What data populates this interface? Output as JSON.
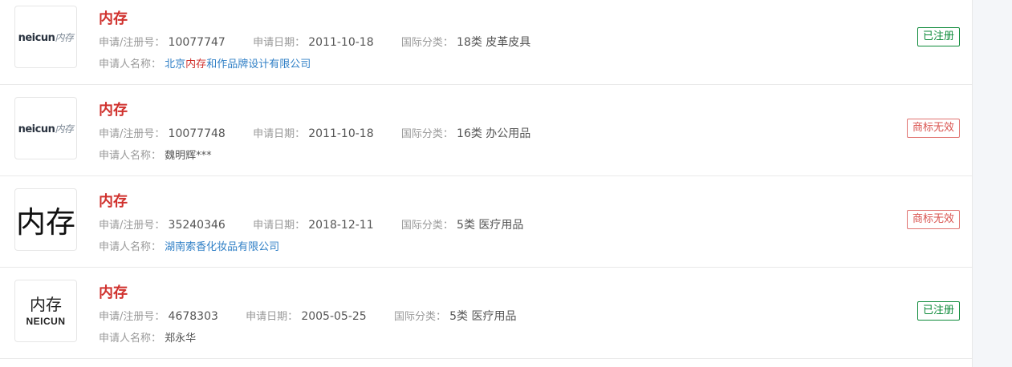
{
  "labels": {
    "reg_no": "申请/注册号：",
    "app_date": "申请日期：",
    "intl_class": "国际分类：",
    "applicant": "申请人名称："
  },
  "logos": {
    "neicun_en": "neicun",
    "neicun_cn": "内存",
    "big_cn": "内存",
    "stack_cn": "内存",
    "stack_en": "NEICUN"
  },
  "items": [
    {
      "title": "内存",
      "reg_no": "10077747",
      "app_date": "2011-10-18",
      "intl_class": "18类 皮革皮具",
      "applicant_pre": "北京",
      "applicant_hl": "内存",
      "applicant_post": "和作品牌设计有限公司",
      "status": "已注册",
      "status_color": "#0d8a39"
    },
    {
      "title": "内存",
      "reg_no": "10077748",
      "app_date": "2011-10-18",
      "intl_class": "16类 办公用品",
      "applicant": "魏明辉***",
      "status": "商标无效",
      "status_color": "#d9534f"
    },
    {
      "title": "内存",
      "reg_no": "35240346",
      "app_date": "2018-12-11",
      "intl_class": "5类 医疗用品",
      "applicant": "湖南索香化妆品有限公司",
      "status": "商标无效",
      "status_color": "#d9534f"
    },
    {
      "title": "内存",
      "reg_no": "4678303",
      "app_date": "2005-05-25",
      "intl_class": "5类 医疗用品",
      "applicant": "郑永华",
      "status": "已注册",
      "status_color": "#0d8a39"
    }
  ],
  "colors": {
    "title": "#d0322e",
    "link": "#2f7fc6",
    "registered": "#0d8a39",
    "invalid": "#d9534f"
  }
}
